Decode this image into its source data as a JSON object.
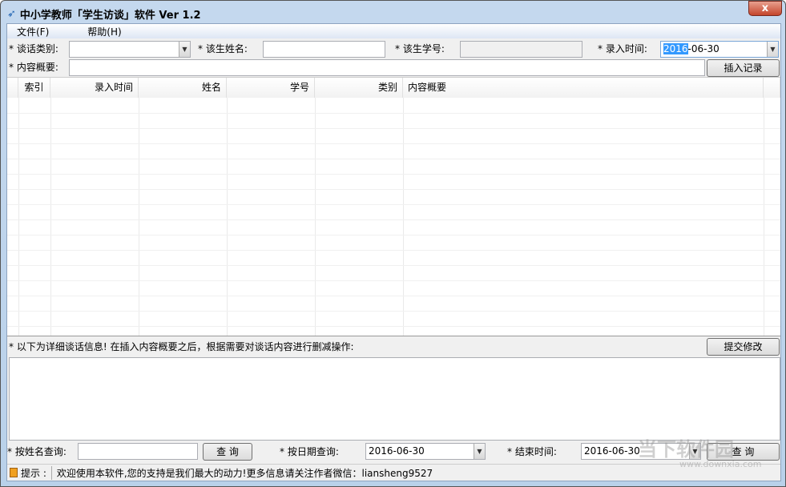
{
  "window": {
    "title": "中小学教师「学生访谈」软件 Ver 1.2",
    "close": "x"
  },
  "menu": [
    "文件(F)",
    "帮助(H)"
  ],
  "form": {
    "category_label": "* 谈话类别:",
    "category_value": "",
    "name_label": "* 该生姓名:",
    "name_value": "",
    "id_label": "* 该生学号:",
    "id_value": "",
    "date_label": "* 录入时间:",
    "date_year": "2016",
    "date_rest": "-06-30",
    "summary_label": "* 内容概要:",
    "summary_value": "",
    "insert_button": "插入记录"
  },
  "grid": {
    "columns": [
      "索引",
      "录入时间",
      "姓名",
      "学号",
      "类别",
      "内容概要"
    ],
    "rows": []
  },
  "detail": {
    "label": "* 以下为详细谈话信息! 在插入内容概要之后，根据需要对谈话内容进行删减操作:",
    "submit_button": "提交修改",
    "text": ""
  },
  "query": {
    "name_label": "* 按姓名查询:",
    "name_value": "",
    "query_button": "查 询",
    "date_label": "* 按日期查询:",
    "date_value": "2016-06-30",
    "end_label": "* 结束时间:",
    "end_value": "2016-06-30",
    "query_button2": "查 询"
  },
  "status": {
    "label": "提示 :",
    "message": "欢迎使用本软件,您的支持是我们最大的动力!更多信息请关注作者微信：liansheng9527"
  },
  "watermark": {
    "text": "当下软件园",
    "url": "www.downxia.com"
  }
}
